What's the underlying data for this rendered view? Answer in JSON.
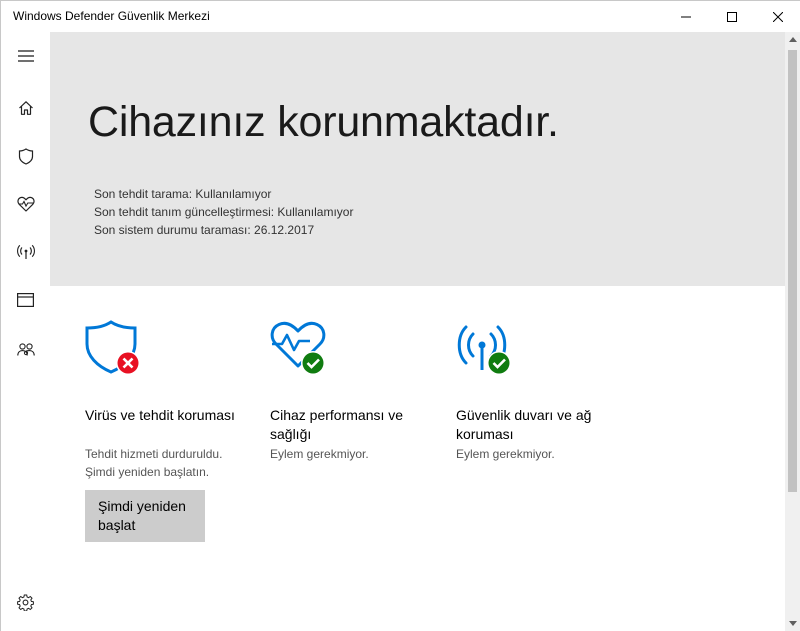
{
  "window": {
    "title": "Windows Defender Güvenlik Merkezi"
  },
  "sidebar": {
    "items": [
      {
        "icon": "hamburger-menu-icon"
      },
      {
        "icon": "home-icon"
      },
      {
        "icon": "shield-icon"
      },
      {
        "icon": "heart-pulse-icon"
      },
      {
        "icon": "wireless-antenna-icon"
      },
      {
        "icon": "browser-window-icon"
      },
      {
        "icon": "family-icon"
      }
    ],
    "settings_icon": "gear-icon"
  },
  "hero": {
    "title": "Cihazınız korunmaktadır.",
    "lines": [
      "Son tehdit tarama: Kullanılamıyor",
      "Son tehdit tanım güncelleştirmesi: Kullanılamıyor",
      "Son sistem durumu taraması: 26.12.2017"
    ]
  },
  "tiles": [
    {
      "icon": "shield-error-icon",
      "title": "Virüs ve tehdit koruması",
      "subtitle": "Tehdit hizmeti durduruldu. Şimdi yeniden başlatın.",
      "button": "Şimdi yeniden başlat",
      "status_color": "#e81123"
    },
    {
      "icon": "heart-check-icon",
      "title": "Cihaz performansı ve sağlığı",
      "subtitle": "Eylem gerekmiyor.",
      "status_color": "#107c10"
    },
    {
      "icon": "antenna-check-icon",
      "title": "Güvenlik duvarı ve ağ koruması",
      "subtitle": "Eylem gerekmiyor.",
      "status_color": "#107c10"
    }
  ],
  "colors": {
    "accent": "#0078d7",
    "hero_bg": "#e6e6e6",
    "ok": "#107c10",
    "error": "#e81123"
  }
}
